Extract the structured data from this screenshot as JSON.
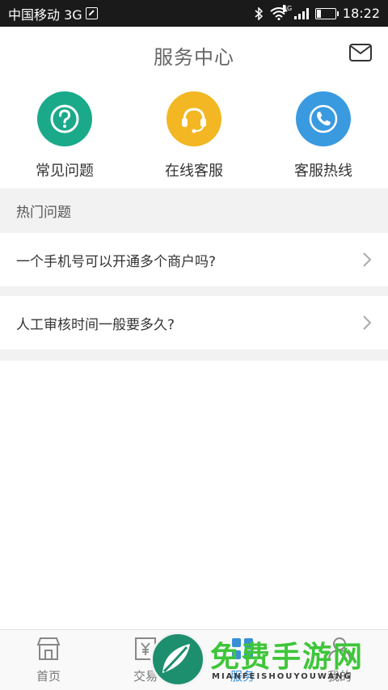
{
  "status_bar": {
    "carrier": "中国移动 3G",
    "signal_tag": "3G",
    "time": "18:22"
  },
  "header": {
    "title": "服务中心"
  },
  "services": [
    {
      "label": "常见问题",
      "icon": "question-icon",
      "color": "#1aaa8a"
    },
    {
      "label": "在线客服",
      "icon": "headset-icon",
      "color": "#f2b722"
    },
    {
      "label": "客服热线",
      "icon": "phone-icon",
      "color": "#3a9ae0"
    }
  ],
  "hot": {
    "title": "热门问题",
    "questions": [
      "一个手机号可以开通多个商户吗?",
      "人工审核时间一般要多久?"
    ]
  },
  "bottom_nav": {
    "items": [
      {
        "label": "首页",
        "icon": "store-icon"
      },
      {
        "label": "交易",
        "icon": "receipt-icon"
      },
      {
        "label": "服务",
        "icon": "grid-icon",
        "active": true
      },
      {
        "label": "我的",
        "icon": "user-icon"
      }
    ]
  },
  "watermark": {
    "text": "免费手游网",
    "sub": "MIANFEISHOUYOUWANG"
  }
}
